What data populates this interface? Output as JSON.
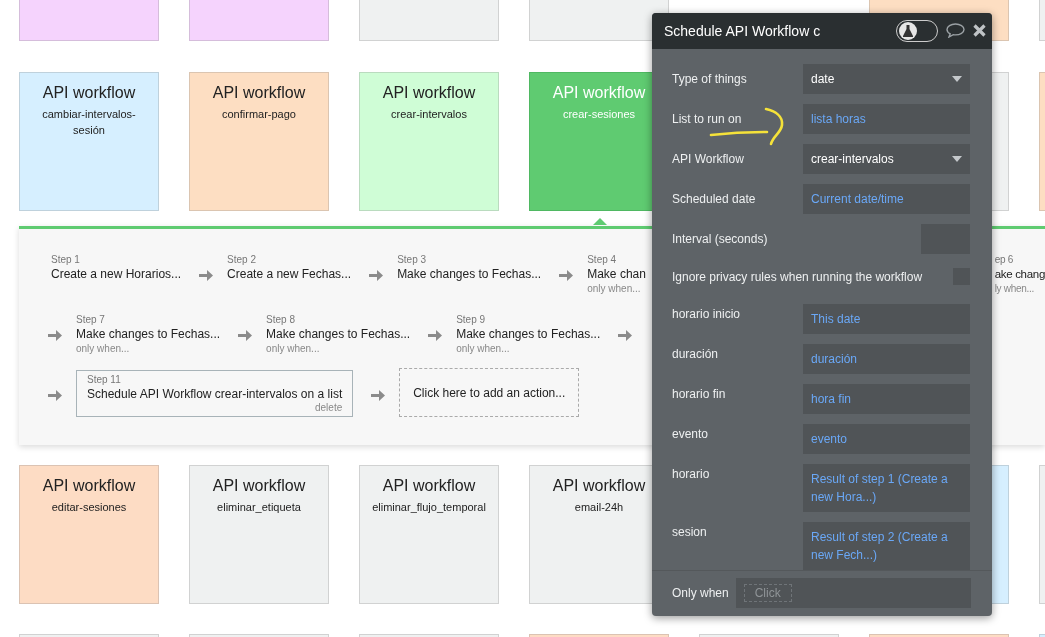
{
  "card_rows": [
    {
      "cards": [
        {
          "color": "#f5d3fd",
          "selected": false
        },
        {
          "color": "#f5d3fd",
          "selected": false
        },
        {
          "color": "#eff1f1",
          "selected": false
        },
        {
          "color": "#eff1f1",
          "selected": false
        },
        {
          "color": "#fddec2",
          "selected": false
        },
        {
          "color": "#eff1f1",
          "selected": false
        }
      ]
    },
    {
      "cards": [
        {
          "title": "API workflow",
          "name": "cambiar-intervalos-sesión",
          "color": "#d6efff",
          "selected": false
        },
        {
          "title": "API workflow",
          "name": "confirmar-pago",
          "color": "#fddec2",
          "selected": false
        },
        {
          "title": "API workflow",
          "name": "crear-intervalos",
          "color": "#cffdd6",
          "selected": false
        },
        {
          "title": "API workflow",
          "name": "crear-sesiones",
          "color": "#5fcb71",
          "selected": true
        },
        {
          "color": "#eff1f1",
          "selected": false
        },
        {
          "color": "#fddec2",
          "selected": false
        }
      ]
    },
    {
      "cards": [
        {
          "title": "API workflow",
          "name": "editar-sesiones",
          "color": "#fddcc4",
          "selected": false
        },
        {
          "title": "API workflow",
          "name": "eliminar_etiqueta",
          "color": "#eff1f1",
          "selected": false
        },
        {
          "title": "API workflow",
          "name": "eliminar_flujo_temporal",
          "color": "#eff1f1",
          "selected": false
        },
        {
          "title": "API workflow",
          "name": "email-24h",
          "color": "#eff1f1",
          "selected": false
        },
        {
          "color": "#d6efff",
          "selected": false
        },
        {
          "color": "#eff1f1",
          "selected": false
        }
      ]
    },
    {
      "cards": [
        {
          "color": "#eff1f1",
          "selected": false
        },
        {
          "color": "#eff1f1",
          "selected": false
        },
        {
          "color": "#eff1f1",
          "selected": false
        },
        {
          "color": "#fddcc4",
          "selected": false
        },
        {
          "color": "#eff1f1",
          "selected": false
        },
        {
          "color": "#fddcc4",
          "selected": false
        },
        {
          "color": "#d6efff",
          "selected": false
        }
      ]
    }
  ],
  "step_rows": [
    {
      "steps": [
        {
          "label": "Step 1",
          "title": "Create a new Horarios...",
          "arrow_before": false,
          "selected": false
        },
        {
          "label": "Step 2",
          "title": "Create a new Fechas...",
          "arrow_before": true,
          "selected": false
        },
        {
          "label": "Step 3",
          "title": "Make changes to Fechas...",
          "arrow_before": true,
          "selected": false
        },
        {
          "label": "Step 4",
          "title": "Make chan",
          "condition": "only when...",
          "arrow_before": true,
          "selected": false
        }
      ],
      "trailing": {
        "label": "ep 6",
        "title": "ake chang",
        "condition": "ly when...",
        "arrow_before": false,
        "selected": false
      }
    },
    {
      "steps": [
        {
          "label": "Step 7",
          "title": "Make changes to Fechas...",
          "condition": "only when...",
          "arrow_before": true,
          "selected": false
        },
        {
          "label": "Step 8",
          "title": "Make changes to Fechas...",
          "condition": "only when...",
          "arrow_before": true,
          "selected": false
        },
        {
          "label": "Step 9",
          "title": "Make changes to Fechas...",
          "condition": "only when...",
          "arrow_before": true,
          "selected": false
        },
        {
          "arrow_before": true
        }
      ]
    },
    {
      "steps": [
        {
          "label": "Step 11",
          "title": "Schedule API Workflow crear-intervalos on a list",
          "action": "delete",
          "arrow_before": true,
          "selected": true
        }
      ],
      "add_action": "Click here to add an action..."
    }
  ],
  "editor": {
    "title": "Schedule API Workflow c",
    "debug_toggle_on": false,
    "fields": [
      {
        "kind": "dropdown",
        "label": "Type of things",
        "value": "date"
      },
      {
        "kind": "dynamic",
        "label": "List to run on",
        "value": "lista horas"
      },
      {
        "kind": "dropdown",
        "label": "API Workflow",
        "value": "crear-intervalos"
      },
      {
        "kind": "dynamic",
        "label": "Scheduled date",
        "value": "Current date/time"
      },
      {
        "kind": "number",
        "label": "Interval (seconds)"
      },
      {
        "kind": "checkbox",
        "label": "Ignore privacy rules when running the workflow",
        "checked": false
      },
      {
        "kind": "dynamic",
        "label": "horario inicio",
        "value": "This date"
      },
      {
        "kind": "dynamic",
        "label": "duración",
        "value": "duración"
      },
      {
        "kind": "dynamic",
        "label": "horario fin",
        "value": "hora fin"
      },
      {
        "kind": "dynamic",
        "label": "evento",
        "value": "evento"
      },
      {
        "kind": "dynamic",
        "label": "horario",
        "value": "Result of step 1 (Create a new Hora...)"
      },
      {
        "kind": "dynamic",
        "label": "sesion",
        "value": "Result of step 2 (Create a new Fech...)"
      }
    ],
    "only_when": {
      "label": "Only when",
      "placeholder": "Click"
    }
  }
}
